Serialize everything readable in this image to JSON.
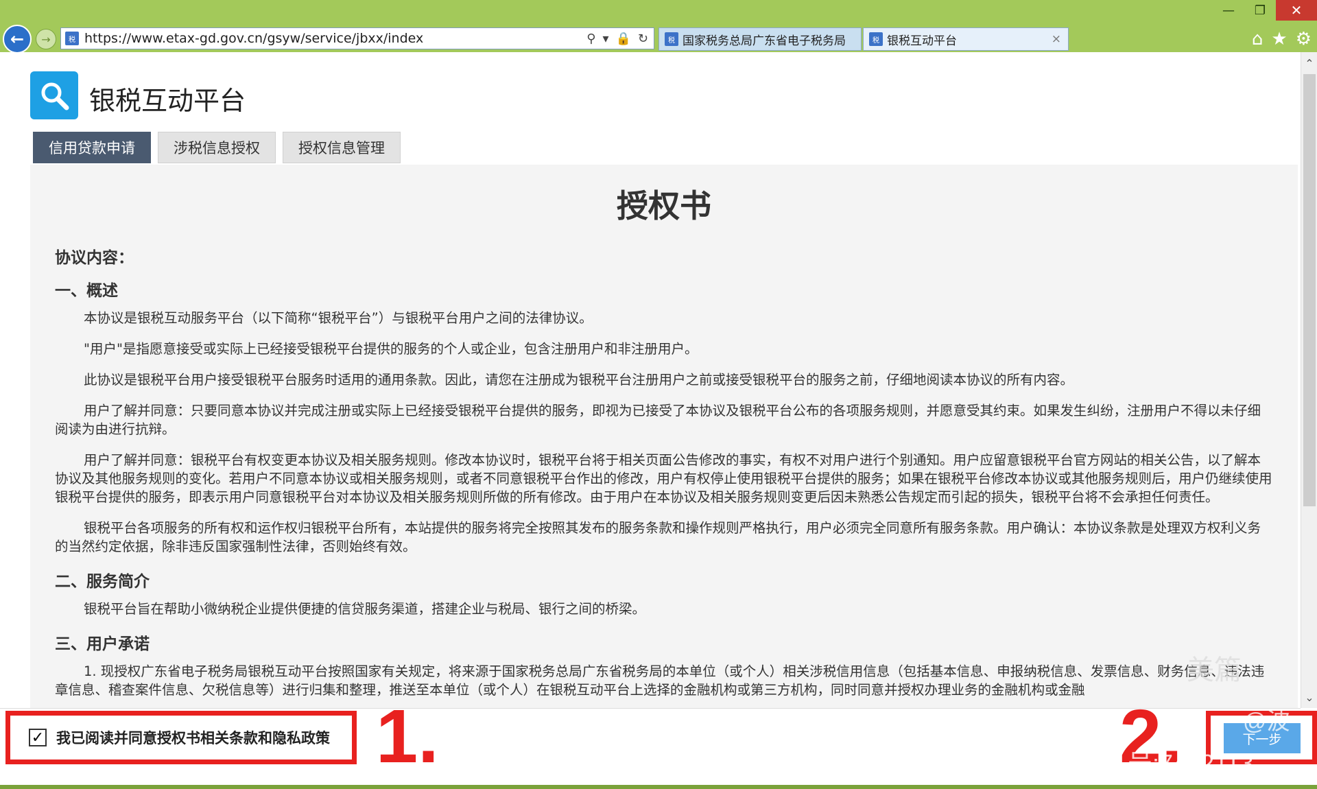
{
  "browser": {
    "url": "https://www.etax-gd.gov.cn/gsyw/service/jbxx/index",
    "tabs": [
      {
        "label": "国家税务总局广东省电子税务局"
      },
      {
        "label": "银税互动平台"
      }
    ],
    "tab_close": "×",
    "favicon_text": "税"
  },
  "site": {
    "title": "银税互动平台"
  },
  "nav": {
    "tabs": [
      {
        "label": "信用贷款申请"
      },
      {
        "label": "涉税信息授权"
      },
      {
        "label": "授权信息管理"
      }
    ]
  },
  "document": {
    "title": "授权书",
    "intro_label": "协议内容：",
    "section1_title": "一、概述",
    "section1_paras": [
      "本协议是银税互动服务平台（以下简称“银税平台”）与银税平台用户之间的法律协议。",
      "\"用户\"是指愿意接受或实际上已经接受银税平台提供的服务的个人或企业，包含注册用户和非注册用户。",
      "此协议是银税平台用户接受银税平台服务时适用的通用条款。因此，请您在注册成为银税平台注册用户之前或接受银税平台的服务之前，仔细地阅读本协议的所有内容。",
      "用户了解并同意：只要同意本协议并完成注册或实际上已经接受银税平台提供的服务，即视为已接受了本协议及银税平台公布的各项服务规则，并愿意受其约束。如果发生纠纷，注册用户不得以未仔细阅读为由进行抗辩。",
      "用户了解并同意：银税平台有权变更本协议及相关服务规则。修改本协议时，银税平台将于相关页面公告修改的事实，有权不对用户进行个别通知。用户应留意银税平台官方网站的相关公告，以了解本协议及其他服务规则的变化。若用户不同意本协议或相关服务规则，或者不同意银税平台作出的修改，用户有权停止使用银税平台提供的服务；如果在银税平台修改本协议或其他服务规则后，用户仍继续使用银税平台提供的服务，即表示用户同意银税平台对本协议及相关服务规则所做的所有修改。由于用户在本协议及相关服务规则变更后因未熟悉公告规定而引起的损失，银税平台将不会承担任何责任。",
      "银税平台各项服务的所有权和运作权归银税平台所有，本站提供的服务将完全按照其发布的服务条款和操作规则严格执行，用户必须完全同意所有服务条款。用户确认：本协议条款是处理双方权利义务的当然约定依据，除非违反国家强制性法律，否则始终有效。"
    ],
    "section2_title": "二、服务简介",
    "section2_paras": [
      "银税平台旨在帮助小微纳税企业提供便捷的信贷服务渠道，搭建企业与税局、银行之间的桥梁。"
    ],
    "section3_title": "三、用户承诺",
    "section3_paras": [
      "1. 现授权广东省电子税务局银税互动平台按照国家有关规定，将来源于国家税务总局广东省税务局的本单位（或个人）相关涉税信用信息（包括基本信息、申报纳税信息、发票信息、财务信息、违法违章信息、稽查案件信息、欠税信息等）进行归集和整理，推送至本单位（或个人）在银税互动平台上选择的金融机构或第三方机构，同时同意并授权办理业务的金融机构或金融"
    ]
  },
  "footer": {
    "agree_text": "我已阅读并同意授权书相关条款和隐私政策",
    "agree_checked": true,
    "next_label": "下一步",
    "marker_1": "1.",
    "marker_2": "2.",
    "watermark_1": "美篇",
    "watermark_2": "@波",
    "watermark_3": "号:7412113"
  },
  "colors": {
    "accent_red": "#e8211f",
    "primary_blue": "#1ea0e4",
    "active_tab": "#4a5a70",
    "chrome_green": "#a3c95a",
    "next_button": "#5aa8e8"
  },
  "icons": {
    "back": "back-arrow-icon",
    "forward": "forward-arrow-icon",
    "search": "search-icon",
    "lock": "lock-icon",
    "refresh": "refresh-icon",
    "home": "home-icon",
    "favorites": "star-icon",
    "settings": "gear-icon"
  }
}
